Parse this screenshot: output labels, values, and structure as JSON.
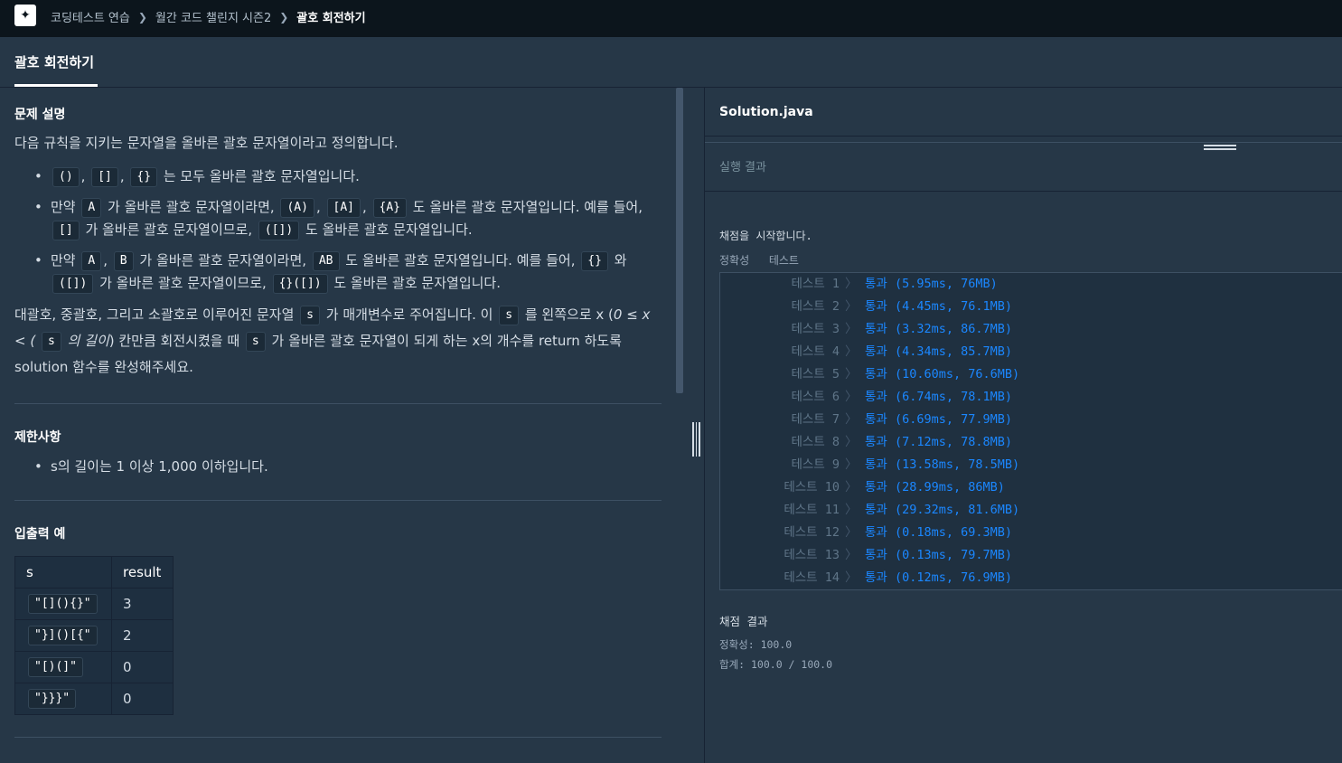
{
  "header": {
    "breadcrumbs": [
      "코딩테스트 연습",
      "월간 코드 챌린지 시즌2",
      "괄호 회전하기"
    ]
  },
  "tab": {
    "label": "괄호 회전하기"
  },
  "problem": {
    "desc_title": "문제 설명",
    "intro": "다음 규칙을 지키는 문자열을 올바른 괄호 문자열이라고 정의합니다.",
    "rule1": {
      "c1": "()",
      "c2": "[]",
      "c3": "{}",
      "text": "는 모두 올바른 괄호 문자열입니다."
    },
    "rule2": {
      "t1": "만약",
      "c1": "A",
      "t2": "가 올바른 괄호 문자열이라면,",
      "c2": "(A)",
      "c3": "[A]",
      "c4": "{A}",
      "t3": "도 올바른 괄호 문자열입니다. 예를 들어,",
      "c5": "[]",
      "t4": "가 올바른 괄호 문자열이므로,",
      "c6": "([])",
      "t5": "도 올바른 괄호 문자열입니다."
    },
    "rule3": {
      "t1": "만약",
      "c1": "A",
      "c2": "B",
      "t2": "가 올바른 괄호 문자열이라면,",
      "c3": "AB",
      "t3": "도 올바른 괄호 문자열입니다. 예를 들어,",
      "c4": "{}",
      "t4": "와",
      "c5": "([])",
      "t5": "가 올바른 괄호 문자열이므로,",
      "c6": "{}([])",
      "t6": "도 올바른 괄호 문자열입니다."
    },
    "para": {
      "t1": "대괄호, 중괄호, 그리고 소괄호로 이루어진 문자열",
      "c1": "s",
      "t2": "가 매개변수로 주어집니다. 이",
      "c2": "s",
      "t3": "를 왼쪽으로 x (",
      "e1": "0 ≤ x < (",
      "c3": "s",
      "e2": "의 길이",
      "t4": ") 칸만큼 회전시켰을 때",
      "c4": "s",
      "t5": "가 올바른 괄호 문자열이 되게 하는 x의 개수를 return 하도록 solution 함수를 완성해주세요."
    },
    "limits_title": "제한사항",
    "limit1": "s의 길이는 1 이상 1,000 이하입니다.",
    "io_title": "입출력 예",
    "io_headers": [
      "s",
      "result"
    ],
    "io_rows": [
      {
        "s": "\"[](){}\"",
        "result": "3"
      },
      {
        "s": "\"}]()[{\"",
        "result": "2"
      },
      {
        "s": "\"[)(]\"",
        "result": "0"
      },
      {
        "s": "\"}}}\"",
        "result": "0"
      }
    ]
  },
  "editor": {
    "filename": "Solution.java",
    "result_tab": "실행 결과"
  },
  "results": {
    "start": "채점을 시작합니다.",
    "acc_header_1": "정확성",
    "acc_header_2": "테스트",
    "tests": [
      {
        "name": "테스트 1",
        "result": "통과 (5.95ms, 76MB)"
      },
      {
        "name": "테스트 2",
        "result": "통과 (4.45ms, 76.1MB)"
      },
      {
        "name": "테스트 3",
        "result": "통과 (3.32ms, 86.7MB)"
      },
      {
        "name": "테스트 4",
        "result": "통과 (4.34ms, 85.7MB)"
      },
      {
        "name": "테스트 5",
        "result": "통과 (10.60ms, 76.6MB)"
      },
      {
        "name": "테스트 6",
        "result": "통과 (6.74ms, 78.1MB)"
      },
      {
        "name": "테스트 7",
        "result": "통과 (6.69ms, 77.9MB)"
      },
      {
        "name": "테스트 8",
        "result": "통과 (7.12ms, 78.8MB)"
      },
      {
        "name": "테스트 9",
        "result": "통과 (13.58ms, 78.5MB)"
      },
      {
        "name": "테스트 10",
        "result": "통과 (28.99ms, 86MB)"
      },
      {
        "name": "테스트 11",
        "result": "통과 (29.32ms, 81.6MB)"
      },
      {
        "name": "테스트 12",
        "result": "통과 (0.18ms, 69.3MB)"
      },
      {
        "name": "테스트 13",
        "result": "통과 (0.13ms, 79.7MB)"
      },
      {
        "name": "테스트 14",
        "result": "통과 (0.12ms, 76.9MB)"
      }
    ],
    "grade_title": "채점 결과",
    "accuracy": "정확성: 100.0",
    "total": "합계: 100.0 / 100.0"
  },
  "colors": {
    "pass": "#1b87ff",
    "background": "#263747",
    "topbar": "#0c151c"
  }
}
